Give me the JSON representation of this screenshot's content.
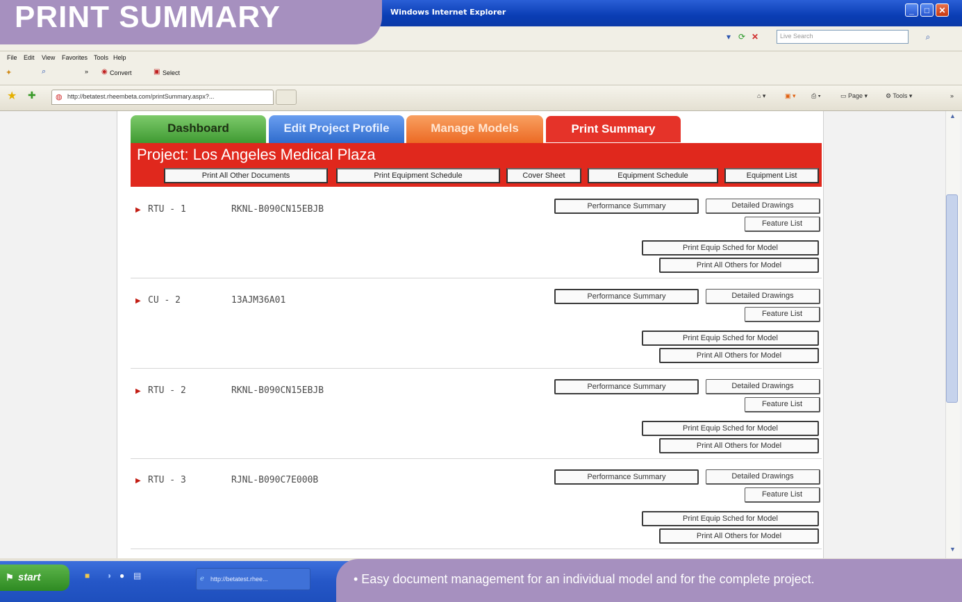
{
  "banner_title": "PRINT SUMMARY",
  "window": {
    "title": "Windows Internet Explorer"
  },
  "browser": {
    "search_placeholder": "Live Search",
    "menu": [
      "File",
      "Edit",
      "View",
      "Favorites",
      "Tools",
      "Help"
    ],
    "toolbar": {
      "convert": "Convert",
      "select": "Select"
    },
    "tab_url": "http://betatest.rheembeta.com/printSummary.aspx?...",
    "tools_right": {
      "page": "Page",
      "tools": "Tools"
    }
  },
  "app": {
    "tabs": [
      "Dashboard",
      "Edit Project Profile",
      "Manage Models",
      "Print Summary"
    ],
    "project_title": "Project: Los Angeles Medical Plaza",
    "top_buttons": [
      "Print All Other Documents",
      "Print Equipment Schedule",
      "Cover Sheet",
      "Equipment Schedule",
      "Equipment List"
    ],
    "model_buttons": {
      "performance": "Performance Summary",
      "drawings": "Detailed Drawings",
      "features": "Feature List",
      "print_equip": "Print Equip Sched for Model",
      "print_all": "Print All Others for Model"
    },
    "models": [
      {
        "tag": "RTU - 1",
        "model": "RKNL-B090CN15EBJB"
      },
      {
        "tag": "CU - 2",
        "model": "13AJM36A01"
      },
      {
        "tag": "RTU - 2",
        "model": "RKNL-B090CN15EBJB"
      },
      {
        "tag": "RTU - 3",
        "model": "RJNL-B090C7E000B"
      }
    ]
  },
  "taskbar": {
    "start": "start",
    "window_button": "http://betatest.rhee..."
  },
  "caption": "• Easy document management for an individual model and for the complete project."
}
